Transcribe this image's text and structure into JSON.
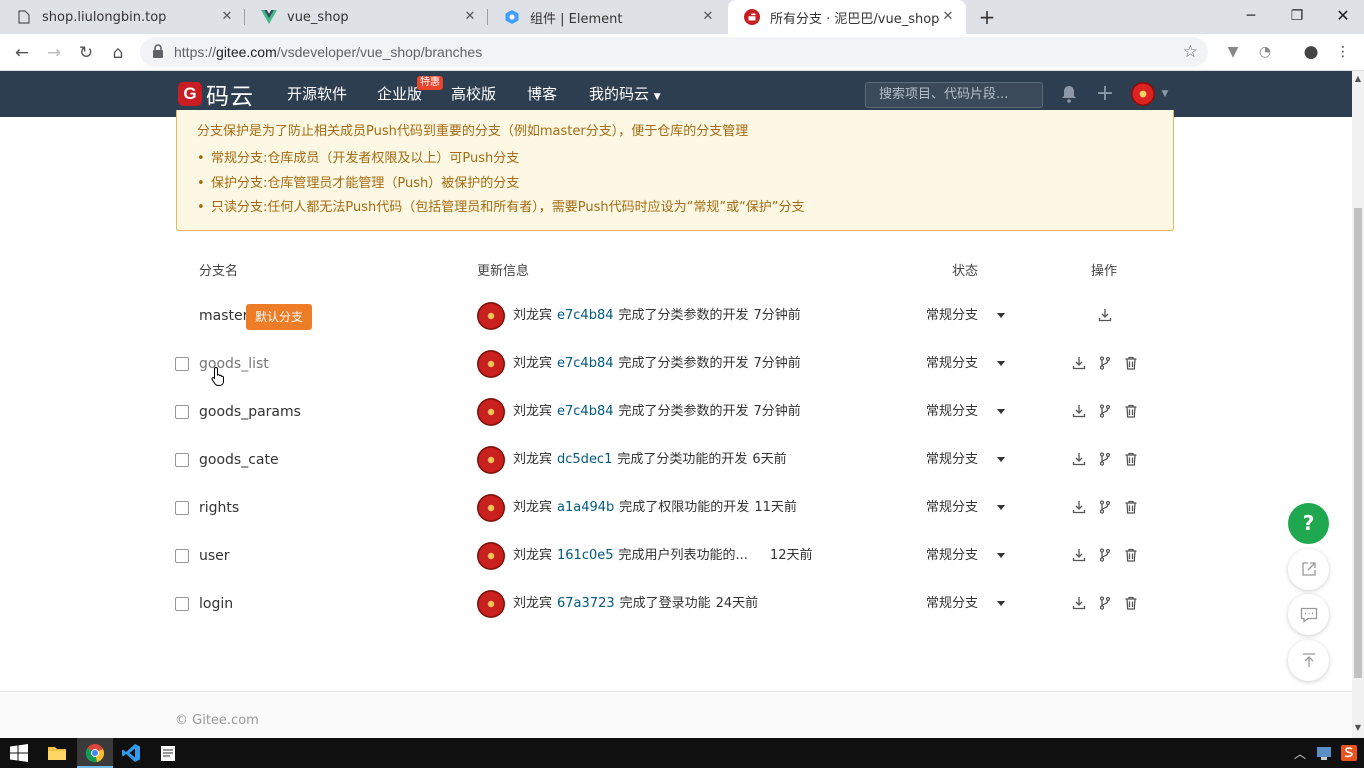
{
  "browser": {
    "tabs": [
      {
        "title": "shop.liulongbin.top",
        "icon": "page-icon"
      },
      {
        "title": "vue_shop",
        "icon": "vue-icon"
      },
      {
        "title": "组件 | Element",
        "icon": "element-icon"
      },
      {
        "title": "所有分支 · 泥巴巴/vue_shop - 码",
        "icon": "gitee-icon",
        "active": true
      }
    ],
    "url_prefix": "https://",
    "url_host": "gitee.com",
    "url_path": "/vsdeveloper/vue_shop/branches"
  },
  "gitee_header": {
    "logo_text": "码云",
    "nav": [
      "开源软件",
      "企业版",
      "高校版",
      "博客",
      "我的码云"
    ],
    "hot_badge": "特惠",
    "search_placeholder": "搜索项目、代码片段..."
  },
  "notice": {
    "intro": "分支保护是为了防止相关成员Push代码到重要的分支（例如master分支），便于仓库的分支管理",
    "items": [
      "常规分支:仓库成员（开发者权限及以上）可Push分支",
      "保护分支:仓库管理员才能管理（Push）被保护的分支",
      "只读分支:任何人都无法Push代码（包括管理员和所有者），需要Push代码时应设为“常规”或“保护”分支"
    ]
  },
  "table": {
    "headers": {
      "name": "分支名",
      "update": "更新信息",
      "status": "状态",
      "ops": "操作"
    },
    "default_badge": "默认分支",
    "rows": [
      {
        "name": "master",
        "author": "刘龙宾",
        "sha": "e7c4b84",
        "message": "完成了分类参数的开发",
        "time": "7分钟前",
        "status": "常规分支",
        "default": true
      },
      {
        "name": "goods_list",
        "author": "刘龙宾",
        "sha": "e7c4b84",
        "message": "完成了分类参数的开发",
        "time": "7分钟前",
        "status": "常规分支"
      },
      {
        "name": "goods_params",
        "author": "刘龙宾",
        "sha": "e7c4b84",
        "message": "完成了分类参数的开发",
        "time": "7分钟前",
        "status": "常规分支"
      },
      {
        "name": "goods_cate",
        "author": "刘龙宾",
        "sha": "dc5dec1",
        "message": "完成了分类功能的开发",
        "time": "6天前",
        "status": "常规分支"
      },
      {
        "name": "rights",
        "author": "刘龙宾",
        "sha": "a1a494b",
        "message": "完成了权限功能的开发",
        "time": "11天前",
        "status": "常规分支"
      },
      {
        "name": "user",
        "author": "刘龙宾",
        "sha": "161c0e5",
        "message": "完成用户列表功能的...",
        "time": "12天前",
        "status": "常规分支"
      },
      {
        "name": "login",
        "author": "刘龙宾",
        "sha": "67a3723",
        "message": "完成了登录功能",
        "time": "24天前",
        "status": "常规分支"
      }
    ]
  },
  "footer": {
    "copyright": "© Gitee.com"
  },
  "floating": {
    "help_label": "?"
  },
  "colors": {
    "header_bg": "#2d3e50",
    "brand_red": "#c71d23",
    "default_badge": "#ef7d27",
    "sha_link": "#005980",
    "help_green": "#1fa84f",
    "notice_text": "#a56b12"
  }
}
